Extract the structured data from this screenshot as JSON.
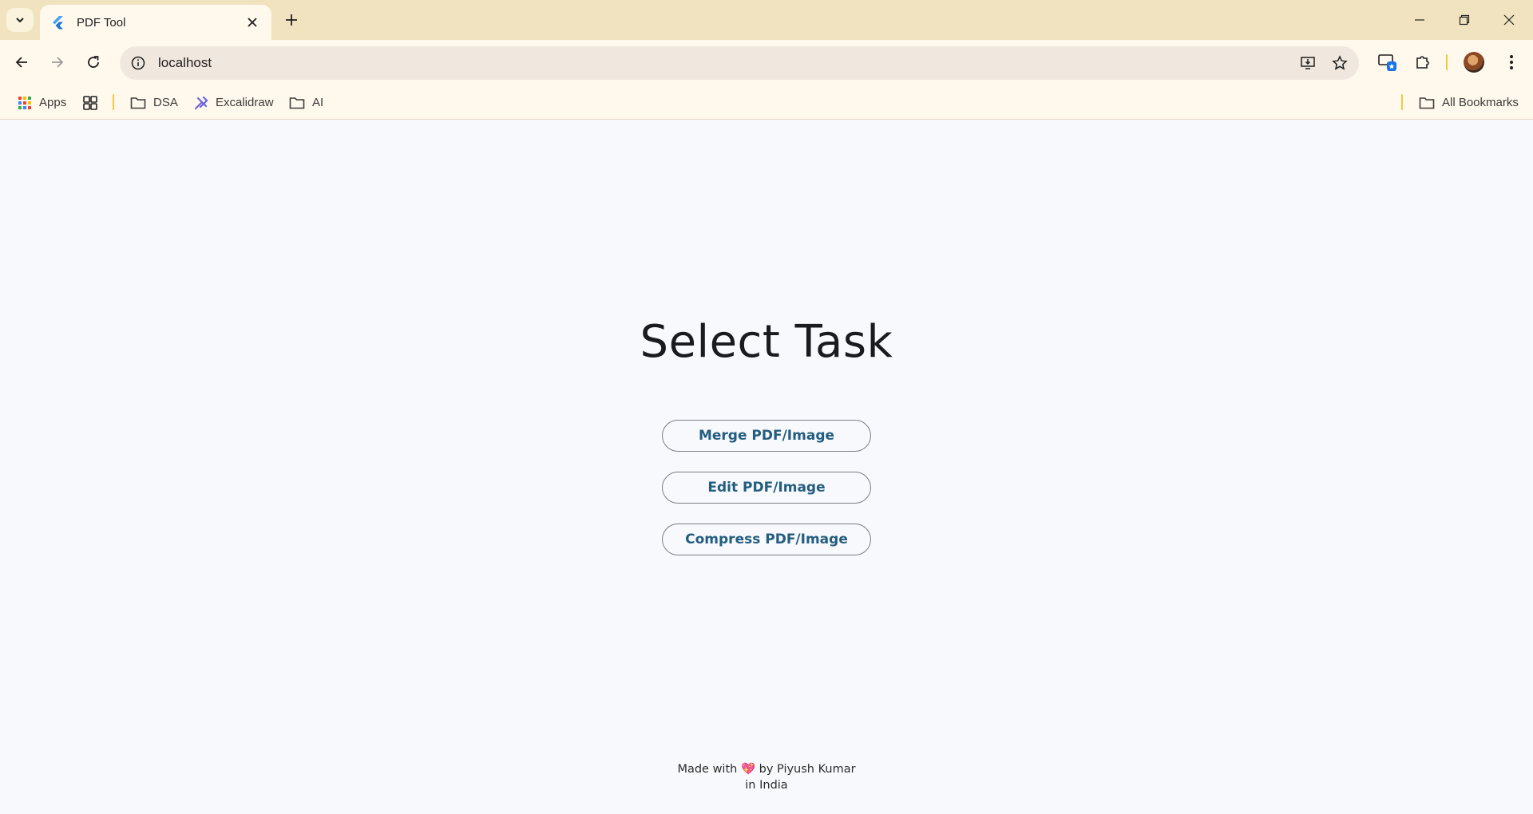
{
  "browser": {
    "tab": {
      "title": "PDF Tool"
    },
    "address": {
      "url": "localhost"
    },
    "bookmarks": [
      {
        "label": "Apps",
        "icon": "apps-grid-icon"
      },
      {
        "label": "",
        "icon": "tab-groups-icon"
      },
      {
        "label": "DSA",
        "icon": "folder-icon"
      },
      {
        "label": "Excalidraw",
        "icon": "excalidraw-icon"
      },
      {
        "label": "AI",
        "icon": "folder-icon"
      }
    ],
    "all_bookmarks": "All Bookmarks"
  },
  "page": {
    "heading": "Select Task",
    "tasks": [
      {
        "label": "Merge PDF/Image"
      },
      {
        "label": "Edit PDF/Image"
      },
      {
        "label": "Compress PDF/Image"
      }
    ],
    "footer": {
      "made_with": "Made with",
      "heart": "💖",
      "by": "by Piyush Kumar",
      "location": "in India"
    }
  },
  "colors": {
    "tabstrip": "#f1e3bf",
    "toolbar": "#fff8ec",
    "page_bg": "#f8f9fc",
    "button_text": "#235d80",
    "button_border": "#7a7d86"
  }
}
